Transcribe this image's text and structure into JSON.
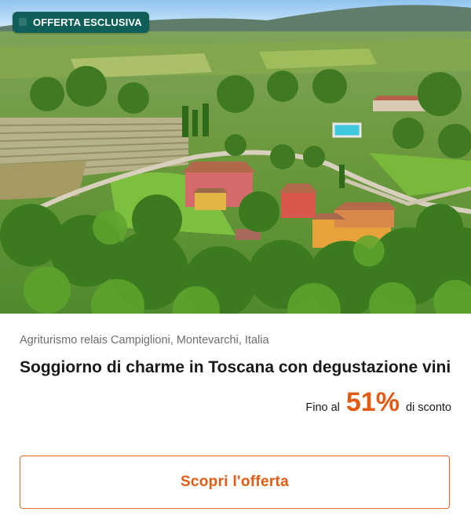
{
  "badge": {
    "label": "OFFERTA ESCLUSIVA"
  },
  "hero": {
    "image": "aerial-view-tuscan-farmhouse-landscape"
  },
  "offer": {
    "location": "Agriturismo relais Campiglioni, Montevarchi, Italia",
    "title": "Soggiorno di charme in Toscana con degustazione vini",
    "discount_prefix": "Fino al",
    "discount_value": "51%",
    "discount_suffix": "di sconto"
  },
  "cta": {
    "label": "Scopri l'offerta"
  },
  "colors": {
    "badge_bg": "#0f5e57",
    "accent": "#e35a12",
    "text": "#1a1a1a",
    "muted": "#6d6d6d"
  }
}
